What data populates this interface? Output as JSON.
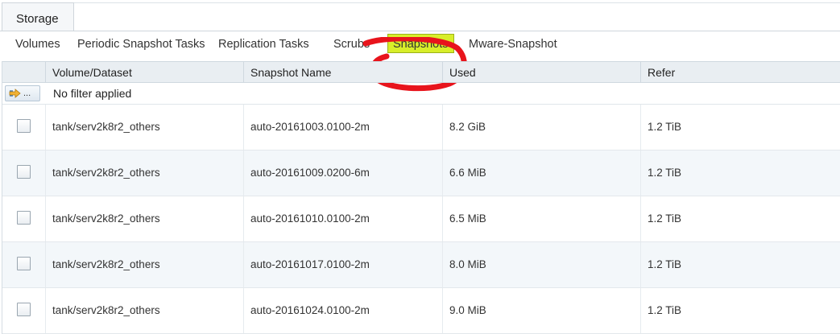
{
  "top_tab": {
    "label": "Storage"
  },
  "sub_tabs": [
    {
      "label": "Volumes"
    },
    {
      "label": "Periodic Snapshot Tasks"
    },
    {
      "label": "Replication Tasks"
    },
    {
      "label": "Scrubs"
    },
    {
      "label": "Snapshots",
      "active": true
    },
    {
      "label": "Mware-Snapshot"
    }
  ],
  "columns": [
    "Volume/Dataset",
    "Snapshot Name",
    "Used",
    "Refer"
  ],
  "filter": {
    "button_label": "...",
    "text": "No filter applied"
  },
  "rows": [
    {
      "volume": "tank/serv2k8r2_others",
      "snapshot": "auto-20161003.0100-2m",
      "used": "8.2 GiB",
      "refer": "1.2 TiB"
    },
    {
      "volume": "tank/serv2k8r2_others",
      "snapshot": "auto-20161009.0200-6m",
      "used": "6.6 MiB",
      "refer": "1.2 TiB"
    },
    {
      "volume": "tank/serv2k8r2_others",
      "snapshot": "auto-20161010.0100-2m",
      "used": "6.5 MiB",
      "refer": "1.2 TiB"
    },
    {
      "volume": "tank/serv2k8r2_others",
      "snapshot": "auto-20161017.0100-2m",
      "used": "8.0 MiB",
      "refer": "1.2 TiB"
    },
    {
      "volume": "tank/serv2k8r2_others",
      "snapshot": "auto-20161024.0100-2m",
      "used": "9.0 MiB",
      "refer": "1.2 TiB"
    }
  ],
  "colors": {
    "active_tab_highlight": "#d8ee29",
    "annotation_ring": "#e8141c",
    "header_bg": "#e9eef2"
  }
}
